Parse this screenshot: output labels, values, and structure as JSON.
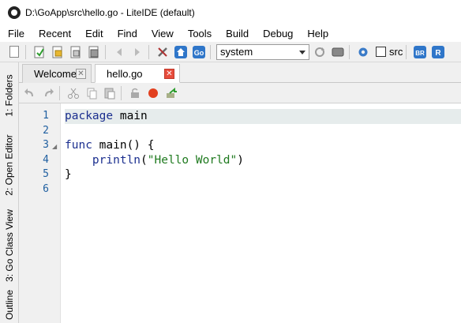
{
  "window": {
    "title": "D:\\GoApp\\src\\hello.go - LiteIDE (default)"
  },
  "menu": {
    "items": [
      "File",
      "Recent",
      "Edit",
      "Find",
      "View",
      "Tools",
      "Build",
      "Debug",
      "Help"
    ]
  },
  "toolbar": {
    "env_selected": "system",
    "src_label": "src",
    "go_label": "Go",
    "br_label": "BR",
    "r_label": "R"
  },
  "sidebar": {
    "tabs": [
      "1: Folders",
      "2: Open Editor",
      "3: Go Class View",
      "Outline"
    ]
  },
  "tabs": [
    {
      "label": "Welcome",
      "active": false
    },
    {
      "label": "hello.go",
      "active": true
    }
  ],
  "editor": {
    "line_numbers": [
      "1",
      "2",
      "3",
      "4",
      "5",
      "6"
    ],
    "lines": {
      "l1_kw": "package",
      "l1_rest": " main",
      "l3_kw": "func",
      "l3_rest": " main() {",
      "l4_indent": "    ",
      "l4_fn": "println",
      "l4_open": "(",
      "l4_str": "\"Hello World\"",
      "l4_close": ")",
      "l5": "}"
    }
  },
  "colors": {
    "accent_close": "#e74c3c",
    "keyword": "#1b2f8f",
    "string": "#1f7a1f",
    "line_number": "#1f5fa0"
  }
}
